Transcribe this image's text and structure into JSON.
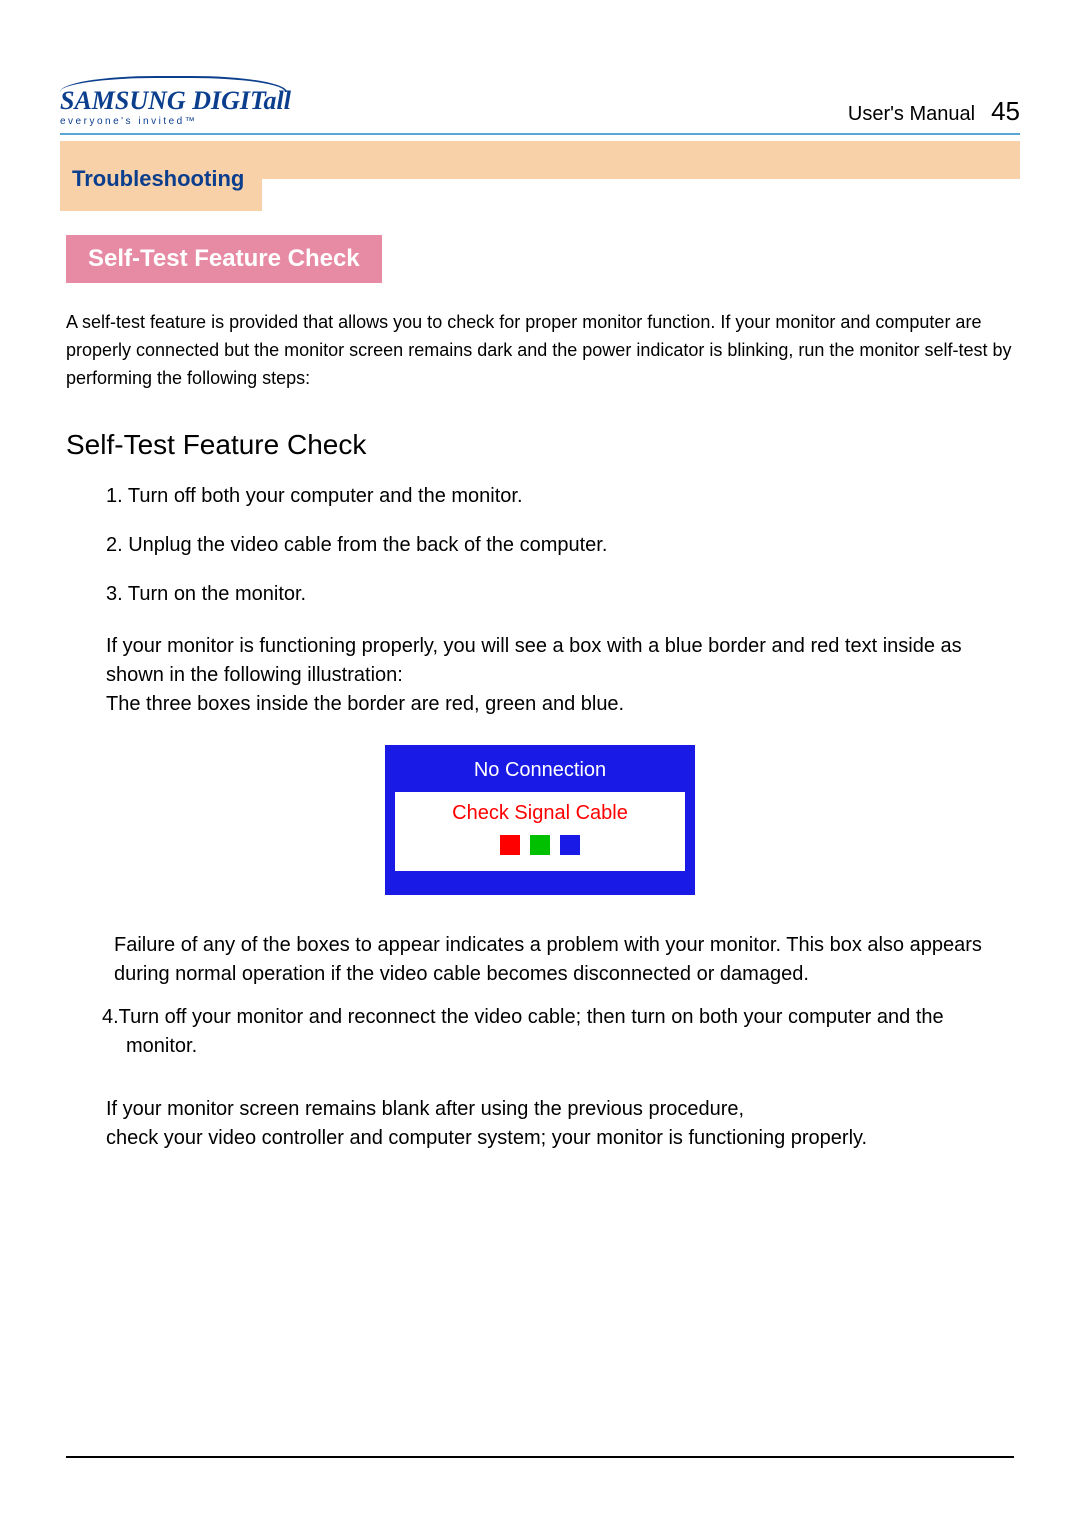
{
  "header": {
    "logo_brand": "SAMSUNG DIGITall",
    "logo_tagline": "everyone's invited™",
    "doc_label": "User's  Manual",
    "page_number": "45"
  },
  "tab": {
    "title": "Troubleshooting"
  },
  "section": {
    "pink_heading": "Self-Test Feature Check",
    "intro": " A self-test feature is provided that allows you to check for proper monitor function. If your monitor and computer are properly connected but the monitor screen remains dark and the power indicator is blinking, run the monitor self-test by performing the following steps:",
    "sub_heading": "Self-Test Feature Check",
    "steps": [
      "1. Turn off both your computer and the monitor.",
      "2. Unplug the video cable from the back of the computer.",
      "3. Turn on the monitor."
    ],
    "after_steps_1": "If your monitor is functioning properly, you will see a box with a blue border and red text inside as shown in the following illustration:",
    "after_steps_2": "The three boxes inside the border are red, green and blue.",
    "diagram": {
      "title": "No Connection",
      "message": "Check Signal Cable"
    },
    "failure_note": "Failure of any of the boxes to appear indicates a problem with your monitor. This box also appears during normal operation if the video cable becomes disconnected or damaged.",
    "step4": "4.Turn off your monitor and reconnect the video cable; then turn on both your computer and the monitor.",
    "closing_1": "If your monitor screen remains blank after using the previous procedure,",
    "closing_2": "check your video controller and computer system; your monitor is functioning properly."
  }
}
